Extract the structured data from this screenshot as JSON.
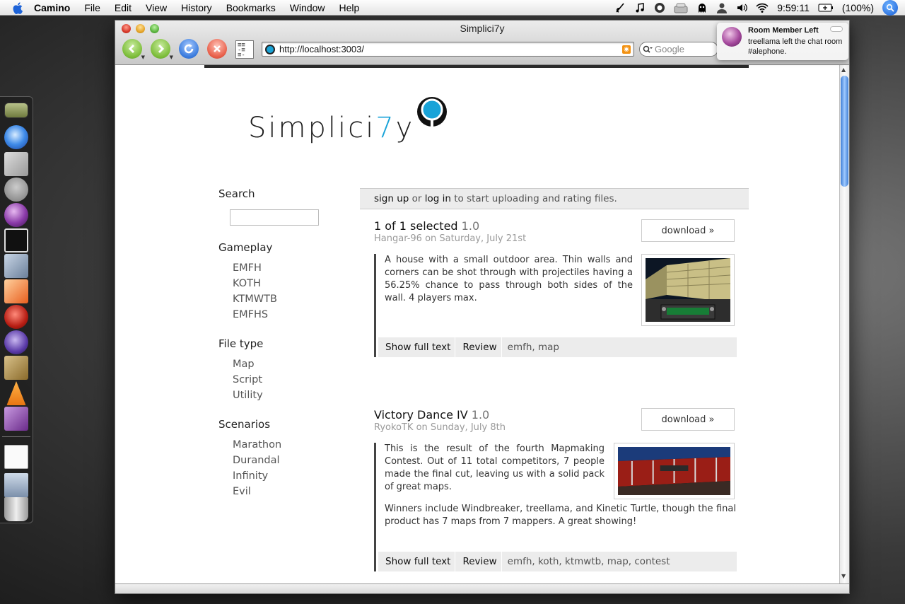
{
  "menubar": {
    "app_name": "Camino",
    "menus": [
      "File",
      "Edit",
      "View",
      "History",
      "Bookmarks",
      "Window",
      "Help"
    ],
    "clock": "9:59:11",
    "battery": "(100%)"
  },
  "window": {
    "title": "Simplici7y",
    "url": "http://localhost:3003/",
    "search_placeholder": "Google"
  },
  "growl": {
    "title": "Room Member Left",
    "body": "treellama left the chat room #alephone."
  },
  "site": {
    "logo_prefix": "Simplici",
    "logo_seven": "7",
    "logo_suffix": "y",
    "sidebar": {
      "search_heading": "Search",
      "gameplay_heading": "Gameplay",
      "gameplay": [
        "EMFH",
        "KOTH",
        "KTMWTB",
        "EMFHS"
      ],
      "filetype_heading": "File type",
      "filetype": [
        "Map",
        "Script",
        "Utility"
      ],
      "scenarios_heading": "Scenarios",
      "scenarios": [
        "Marathon",
        "Durandal",
        "Infinity",
        "Evil"
      ]
    },
    "signup": {
      "signup_link": "sign up",
      "or": "or",
      "login_link": "log in",
      "rest": "to start uploading and rating files."
    },
    "entries": [
      {
        "title": "1 of 1 selected",
        "version": "1.0",
        "meta": "Hangar-96 on Saturday, July 21st",
        "download": "download »",
        "description": "A house with a small outdoor area. Thin walls and corners can be shot through with projectiles having a 56.25% chance to pass through both sides of the wall. 4 players max.",
        "show_full": "Show full text",
        "review": "Review",
        "tags": "emfh, map"
      },
      {
        "title": "Victory Dance IV",
        "version": "1.0",
        "meta": "RyokoTK on Sunday, July 8th",
        "download": "download »",
        "description": "This is the result of the fourth Mapmaking Contest. Out of 11 total competitors, 7 people made the final cut, leaving us with a solid pack of great maps.",
        "description2": "Winners include Windbreaker, treellama, and Kinetic Turtle, though the final product has 7 maps from 7 mappers. A great showing!",
        "show_full": "Show full text",
        "review": "Review",
        "tags": "emfh, koth, ktmwtb, map, contest"
      }
    ]
  },
  "colors": {
    "accent": "#19a3d8",
    "text_dark": "#111111",
    "text_muted": "#999999"
  }
}
